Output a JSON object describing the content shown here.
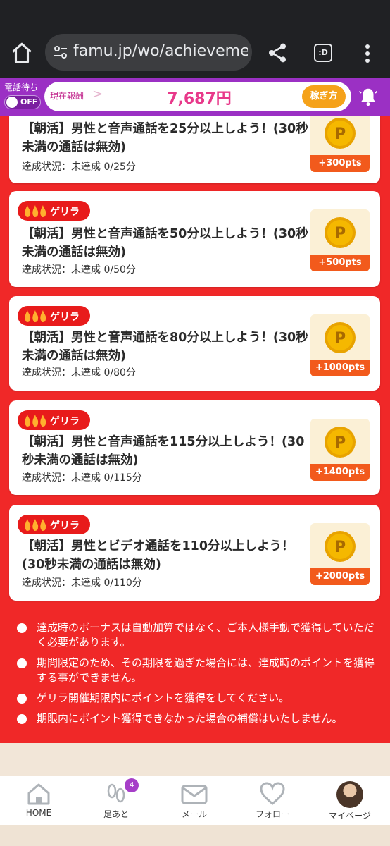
{
  "browser": {
    "url": "famu.jp/wo/achievement/",
    "tabs_label": ":D"
  },
  "header": {
    "wait_label": "電話待ち",
    "toggle_state": "OFF",
    "reward_label": "現在報酬",
    "reward_amount": "7,687円",
    "earn_button": "稼ぎ方"
  },
  "badge_label": "ゲリラ",
  "cards": [
    {
      "title": "【朝活】男性と音声通話を25分以上しよう！(30秒未満の通話は無効)",
      "status": "達成状況：未達成 0/25分",
      "points": "+300pts"
    },
    {
      "title": "【朝活】男性と音声通話を50分以上しよう！(30秒未満の通話は無効)",
      "status": "達成状況：未達成 0/50分",
      "points": "+500pts"
    },
    {
      "title": "【朝活】男性と音声通話を80分以上しよう！(30秒未満の通話は無効)",
      "status": "達成状況：未達成 0/80分",
      "points": "+1000pts"
    },
    {
      "title": "【朝活】男性と音声通話を115分以上しよう！(30秒未満の通話は無効)",
      "status": "達成状況：未達成 0/115分",
      "points": "+1400pts"
    },
    {
      "title": "【朝活】男性とビデオ通話を110分以上しよう！(30秒未満の通話は無効)",
      "status": "達成状況：未達成 0/110分",
      "points": "+2000pts"
    }
  ],
  "notes": [
    "達成時のボーナスは自動加算ではなく、ご本人様手動で獲得していただく必要があります。",
    "期間限定のため、その期限を過ぎた場合には、達成時のポイントを獲得する事ができません。",
    "ゲリラ開催期限内にポイントを獲得をしてください。",
    "期限内にポイント獲得できなかった場合の補償はいたしません。"
  ],
  "nav": {
    "home": "HOME",
    "footprints": "足あと",
    "footprints_badge": "4",
    "mail": "メール",
    "follow": "フォロー",
    "mypage": "マイページ"
  },
  "colors": {
    "header_purple": "#9b30c4",
    "content_red": "#f02828",
    "points_orange": "#f25a1c",
    "coin_gold": "#f5b800"
  }
}
